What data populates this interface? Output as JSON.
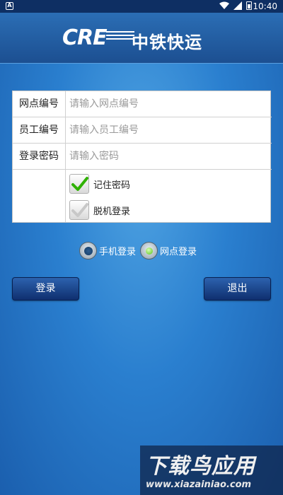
{
  "status_bar": {
    "app_indicator": "A",
    "time": "10:40",
    "icons": [
      "wifi-icon",
      "signal-icon",
      "battery-icon"
    ]
  },
  "header": {
    "logo_latin": "CRE",
    "logo_cn": "中铁快运"
  },
  "form": {
    "fields": [
      {
        "label": "网点编号",
        "placeholder": "请输入网点编号"
      },
      {
        "label": "员工编号",
        "placeholder": "请输入员工编号"
      },
      {
        "label": "登录密码",
        "placeholder": "请输入密码"
      }
    ],
    "options": [
      {
        "label": "记住密码",
        "checked": true
      },
      {
        "label": "脱机登录",
        "checked": false
      }
    ]
  },
  "login_mode": {
    "options": [
      {
        "label": "手机登录",
        "selected": false
      },
      {
        "label": "网点登录",
        "selected": true
      }
    ]
  },
  "buttons": {
    "login": "登录",
    "exit": "退出"
  },
  "watermark": {
    "title": "下载鸟应用",
    "url": "www.xiazainiao.com"
  },
  "colors": {
    "header": "#1c4f91",
    "background": "#2a7fcf",
    "button": "#0f2f6f",
    "check_green": "#2fb100"
  }
}
